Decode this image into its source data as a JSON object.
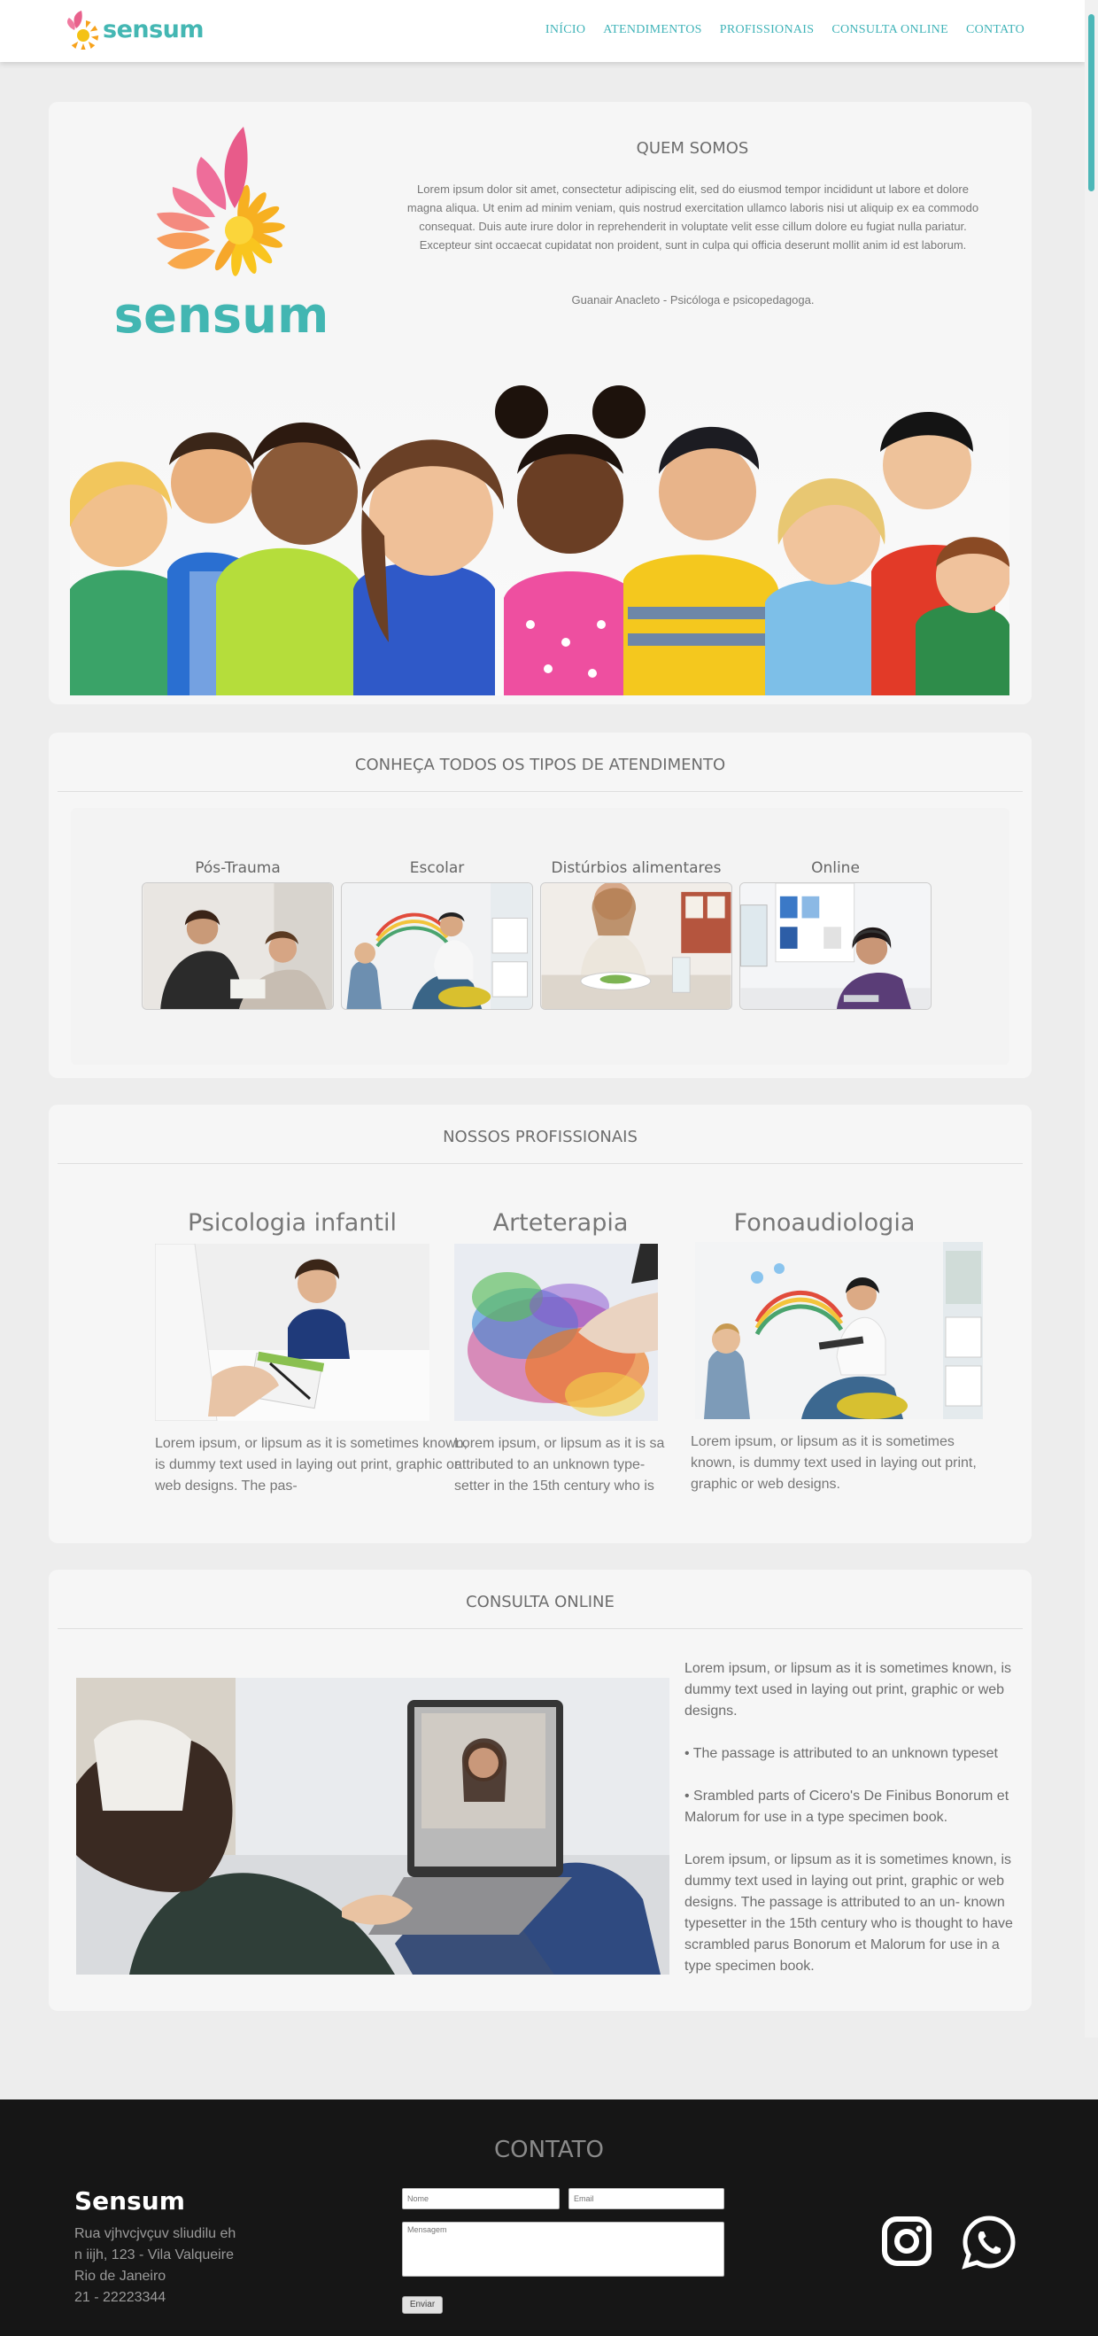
{
  "header": {
    "brand": "sensum",
    "nav": [
      "INÍCIO",
      "ATENDIMENTOS",
      "PROFISSIONAIS",
      "CONSULTA ONLINE",
      "CONTATO"
    ]
  },
  "about": {
    "logo_text": "sensum",
    "title": "QUEM SOMOS",
    "text": "Lorem ipsum dolor sit amet, consectetur adipiscing elit, sed do eiusmod tempor incididunt ut labore et dolore magna aliqua. Ut enim ad minim veniam, quis nostrud exercitation ullamco laboris nisi ut aliquip ex ea commodo consequat. Duis aute irure dolor in reprehenderit in voluptate velit esse cillum dolore eu fugiat nulla pariatur. Excepteur sint occaecat cupidatat non proident, sunt in culpa qui officia deserunt mollit anim id est laborum.",
    "signature": "Guanair Anacleto - Psicóloga e psicopedagoga."
  },
  "atendimentos": {
    "title": "CONHEÇA TODOS OS TIPOS DE ATENDIMENTO",
    "items": [
      "Pós-Trauma",
      "Escolar",
      "Distúrbios alimentares",
      "Online"
    ]
  },
  "profissionais": {
    "title": "NOSSOS PROFISSIONAIS",
    "items": [
      {
        "title": "Psicologia infantil",
        "text": "Lorem ipsum, or lipsum as it is sometimes known, is dummy text used in laying out print, graphic or web designs. The pas-"
      },
      {
        "title": "Arteterapia",
        "text": "Lorem ipsum, or lipsum as it is sa attributed to an unknown type- setter in the 15th century who is"
      },
      {
        "title": "Fonoaudiologia",
        "text": "Lorem ipsum, or lipsum as it is sometimes known, is dummy text used in laying out print, graphic or web designs."
      }
    ]
  },
  "consulta": {
    "title": "CONSULTA ONLINE",
    "paragraphs": [
      "Lorem ipsum, or lipsum as it is sometimes known, is dummy text used in laying out print, graphic or web designs.",
      "• The passage is attributed to an unknown typeset",
      "• Srambled parts of Cicero's De Finibus Bonorum et Malorum for use in a type specimen book.",
      "Lorem ipsum, or lipsum as it is sometimes known, is dummy text used in laying out print, graphic or web designs. The passage is attributed to an un- known typesetter in the 15th century who is thought to have scrambled parus Bonorum et Malorum for use in a type specimen book."
    ]
  },
  "footer": {
    "title": "CONTATO",
    "brand": "Sensum",
    "address": [
      "Rua vjhvcjvçuv sliudilu eh",
      "n iijh, 123 - Vila Valqueire",
      "Rio de Janeiro",
      "21 - 22223344"
    ],
    "name_placeholder": "Nome",
    "email_placeholder": "Email",
    "message_placeholder": "Mensagem",
    "send_label": "Enviar"
  },
  "colors": {
    "accent": "#3fb3b8",
    "footer_bg": "#161616",
    "panel_bg": "#f6f6f6"
  }
}
